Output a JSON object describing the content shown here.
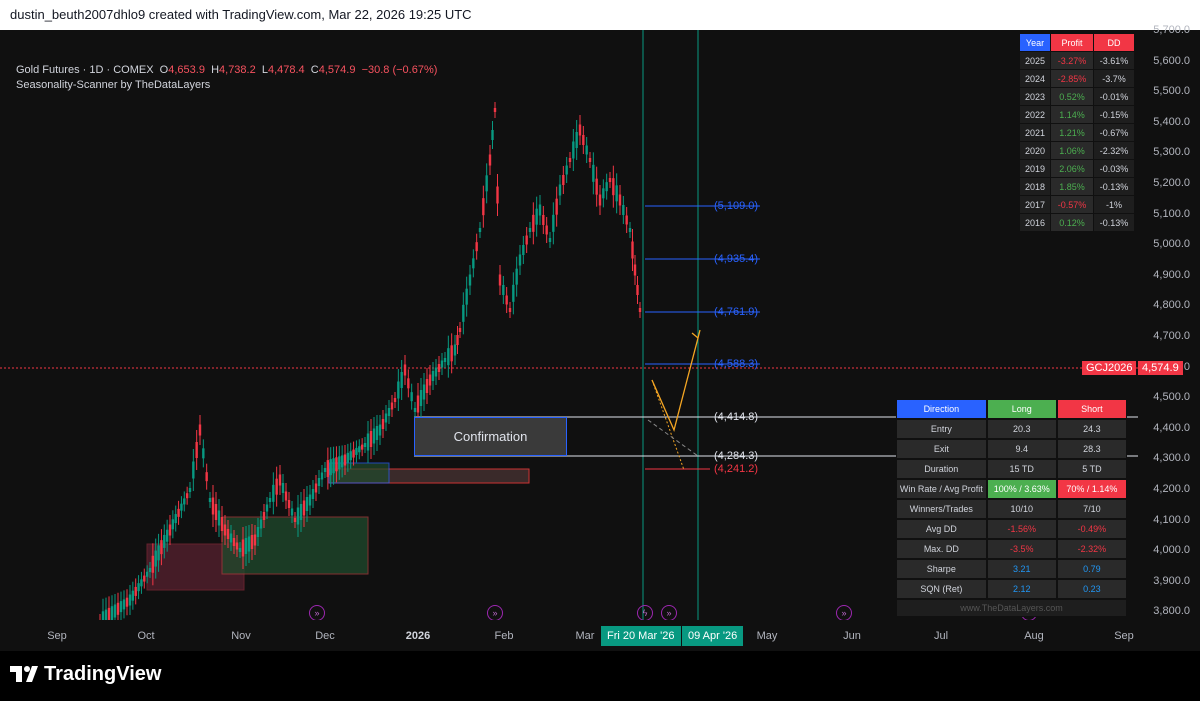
{
  "header": {
    "attribution": "dustin_beuth2007dhlo9 created with TradingView.com, Mar 22, 2026 19:25 UTC"
  },
  "legend": {
    "symbol": "Gold Futures · 1D · COMEX",
    "o_label": "O",
    "o_val": "4,653.9",
    "h_label": "H",
    "h_val": "4,738.2",
    "l_label": "L",
    "l_val": "4,478.4",
    "c_label": "C",
    "c_val": "4,574.9",
    "change": "−30.8 (−0.67%)",
    "indicator": "Seasonality-Scanner by TheDataLayers"
  },
  "y_axis": {
    "ticks": [
      "5,700.0",
      "5,600.0",
      "5,500.0",
      "5,400.0",
      "5,300.0",
      "5,200.0",
      "5,100.0",
      "5,000.0",
      "4,900.0",
      "4,800.0",
      "4,700.0",
      "4,600.0",
      "4,500.0",
      "4,400.0",
      "4,300.0",
      "4,200.0",
      "4,100.0",
      "4,000.0",
      "3,900.0",
      "3,800.0"
    ]
  },
  "price_tags": {
    "symbol_tag": "GCJ2026",
    "last_price": "4,574.9"
  },
  "x_axis": {
    "ticks": [
      "Sep",
      "Oct",
      "Nov",
      "Dec",
      "2026",
      "Feb",
      "Mar",
      "May",
      "Jun",
      "Jul",
      "Aug",
      "Sep"
    ],
    "highlight_1": "Fri 20 Mar '26",
    "highlight_2": "09 Apr '26"
  },
  "levels": [
    "(5,109.0)",
    "(4,935.4)",
    "(4,761.9)",
    "(4,588.3)",
    "(4,414.8)",
    "(4,284.3)",
    "(4,241.2)"
  ],
  "confirmation_label": "Confirmation",
  "seasonality_table": {
    "headers": [
      "Year",
      "Profit",
      "DD"
    ],
    "rows": [
      [
        "2025",
        "-3.27%",
        "-3.61%"
      ],
      [
        "2024",
        "-2.85%",
        "-3.7%"
      ],
      [
        "2023",
        "0.52%",
        "-0.01%"
      ],
      [
        "2022",
        "1.14%",
        "-0.15%"
      ],
      [
        "2021",
        "1.21%",
        "-0.67%"
      ],
      [
        "2020",
        "1.06%",
        "-2.32%"
      ],
      [
        "2019",
        "2.06%",
        "-0.03%"
      ],
      [
        "2018",
        "1.85%",
        "-0.13%"
      ],
      [
        "2017",
        "-0.57%",
        "-1%"
      ],
      [
        "2016",
        "0.12%",
        "-0.13%"
      ]
    ]
  },
  "stats_table": {
    "headers": [
      "Direction",
      "Long",
      "Short"
    ],
    "rows": [
      [
        "Entry",
        "20.3",
        "24.3"
      ],
      [
        "Exit",
        "9.4",
        "28.3"
      ],
      [
        "Duration",
        "15 TD",
        "5 TD"
      ],
      [
        "Win Rate / Avg Profit",
        "100% / 3.63%",
        "70% / 1.14%"
      ],
      [
        "Winners/Trades",
        "10/10",
        "7/10"
      ],
      [
        "Avg DD",
        "-1.56%",
        "-0.49%"
      ],
      [
        "Max. DD",
        "-3.5%",
        "-2.32%"
      ],
      [
        "Sharpe",
        "3.21",
        "0.79"
      ],
      [
        "SQN (Ret)",
        "2.12",
        "0.23"
      ]
    ],
    "footer": "www.TheDataLayers.com"
  },
  "footer": {
    "brand": "TradingView"
  },
  "colors": {
    "up": "#089981",
    "down": "#f23645",
    "blue": "#2962ff",
    "teal_line": "#089981"
  }
}
